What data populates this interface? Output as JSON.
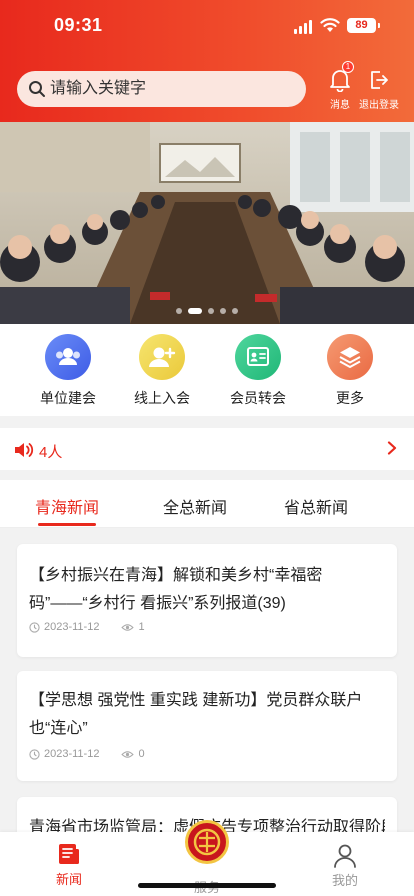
{
  "status": {
    "time": "09:31",
    "battery": "89"
  },
  "header": {
    "search_placeholder": "请输入关键字",
    "message_label": "消息",
    "message_badge": "1",
    "logout_label": "退出登录"
  },
  "banner": {
    "image": "会议室座谈会照片",
    "slides": 5,
    "active_slide": 1
  },
  "quick_actions": [
    {
      "label": "单位建会",
      "icon": "group-icon",
      "color": "#4c6ff0"
    },
    {
      "label": "线上入会",
      "icon": "add-user-icon",
      "color": "#f2d64b"
    },
    {
      "label": "会员转会",
      "icon": "id-card-icon",
      "color": "#2fc387"
    },
    {
      "label": "更多",
      "icon": "layers-icon",
      "color": "#f07b54"
    }
  ],
  "notice": {
    "text": "4人"
  },
  "tabs": [
    "青海新闻",
    "全总新闻",
    "省总新闻"
  ],
  "news": [
    {
      "title": "【乡村振兴在青海】解锁和美乡村“幸福密码”——“乡村行 看振兴”系列报道(39)",
      "date": "2023-11-12",
      "views": "1"
    },
    {
      "title": "【学思想 强党性 重实践 建新功】党员群众联户也“连心”",
      "date": "2023-11-12",
      "views": "0"
    },
    {
      "title": "青海省市场监管局：虚假广告专项整治行动取得阶段"
    }
  ],
  "tabbar": {
    "news": "新闻",
    "service": "服务",
    "mine": "我的"
  },
  "colors": {
    "brand": "#e8291d"
  }
}
